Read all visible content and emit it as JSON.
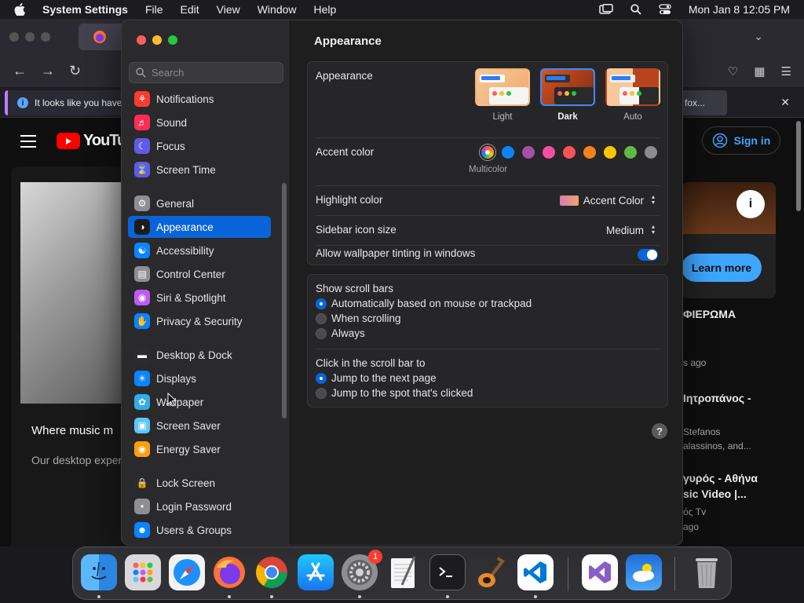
{
  "menubar": {
    "app_name": "System Settings",
    "items": [
      "File",
      "Edit",
      "View",
      "Window",
      "Help"
    ],
    "clock": "Mon Jan 8  12:05 PM"
  },
  "browser": {
    "notice_text": "It looks like you have",
    "notice_right": "fox...",
    "youtube_logo": "YouTube",
    "signin_label": "Sign in",
    "learn_more_label": "Learn more",
    "card_title": "Where music m",
    "card_sub": "Our desktop exper",
    "right_texts": [
      "ΦΙΕΡΩΜΑ",
      "s ago",
      "Ιητροπάνος -",
      "Stefanos",
      "alassinos, and...",
      "γυρός - Αθήνα",
      "sic Video |...",
      "ός Tv",
      "ago"
    ]
  },
  "settings": {
    "search_placeholder": "Search",
    "sidebar": [
      {
        "label": "Notifications",
        "icon": "bell-icon",
        "color": "#ff3b30"
      },
      {
        "label": "Sound",
        "icon": "speaker-icon",
        "color": "#ff2d55"
      },
      {
        "label": "Focus",
        "icon": "moon-icon",
        "color": "#5e5ce6"
      },
      {
        "label": "Screen Time",
        "icon": "hourglass-icon",
        "color": "#5e5ce6"
      },
      {
        "label": "General",
        "icon": "gear-icon",
        "color": "#8e8e93"
      },
      {
        "label": "Appearance",
        "icon": "appearance-icon",
        "color": "#1c1c1e"
      },
      {
        "label": "Accessibility",
        "icon": "accessibility-icon",
        "color": "#0a84ff"
      },
      {
        "label": "Control Center",
        "icon": "control-center-icon",
        "color": "#8e8e93"
      },
      {
        "label": "Siri & Spotlight",
        "icon": "siri-icon",
        "color": "#bf5af2"
      },
      {
        "label": "Privacy & Security",
        "icon": "hand-icon",
        "color": "#0a84ff"
      },
      {
        "label": "Desktop & Dock",
        "icon": "dock-icon",
        "color": "#2c2c2e"
      },
      {
        "label": "Displays",
        "icon": "sun-icon",
        "color": "#0a84ff"
      },
      {
        "label": "Wallpaper",
        "icon": "flower-icon",
        "color": "#32ade6"
      },
      {
        "label": "Screen Saver",
        "icon": "screensaver-icon",
        "color": "#5ac8fa"
      },
      {
        "label": "Energy Saver",
        "icon": "bulb-icon",
        "color": "#ff9f0a"
      },
      {
        "label": "Lock Screen",
        "icon": "lock-icon",
        "color": "#2c2c2e"
      },
      {
        "label": "Login Password",
        "icon": "password-icon",
        "color": "#8e8e93"
      },
      {
        "label": "Users & Groups",
        "icon": "users-icon",
        "color": "#0a84ff"
      }
    ],
    "active_item": "Appearance",
    "title": "Appearance",
    "appearance_label": "Appearance",
    "themes": [
      "Light",
      "Dark",
      "Auto"
    ],
    "selected_theme": "Dark",
    "accent_label": "Accent color",
    "accent_caption": "Multicolor",
    "accent_colors": [
      "#0a84ff",
      "#a550a7",
      "#f74f9e",
      "#ff5257",
      "#f7821b",
      "#ffc600",
      "#62ba46",
      "#8c8c8c"
    ],
    "highlight_label": "Highlight color",
    "highlight_value": "Accent Color",
    "icon_size_label": "Sidebar icon size",
    "icon_size_value": "Medium",
    "tinting_label": "Allow wallpaper tinting in windows",
    "tinting_on": true,
    "scrollbars_label": "Show scroll bars",
    "scrollbar_options": [
      "Automatically based on mouse or trackpad",
      "When scrolling",
      "Always"
    ],
    "click_label": "Click in the scroll bar to",
    "click_options": [
      "Jump to the next page",
      "Jump to the spot that's clicked"
    ],
    "help_label": "?"
  },
  "dock": {
    "settings_badge": "1"
  }
}
